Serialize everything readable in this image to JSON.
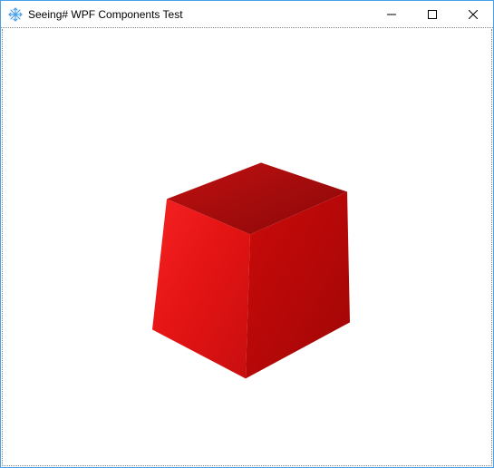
{
  "window": {
    "title": "Seeing# WPF Components Test",
    "icon": "snowflake-app-icon",
    "controls": {
      "minimize": "minimize",
      "maximize": "maximize",
      "close": "close"
    }
  },
  "scene": {
    "object": "cube",
    "faces": {
      "top": "#a30c0c",
      "front": "#e51414",
      "right": "#c00808"
    },
    "background": "#ffffff"
  }
}
